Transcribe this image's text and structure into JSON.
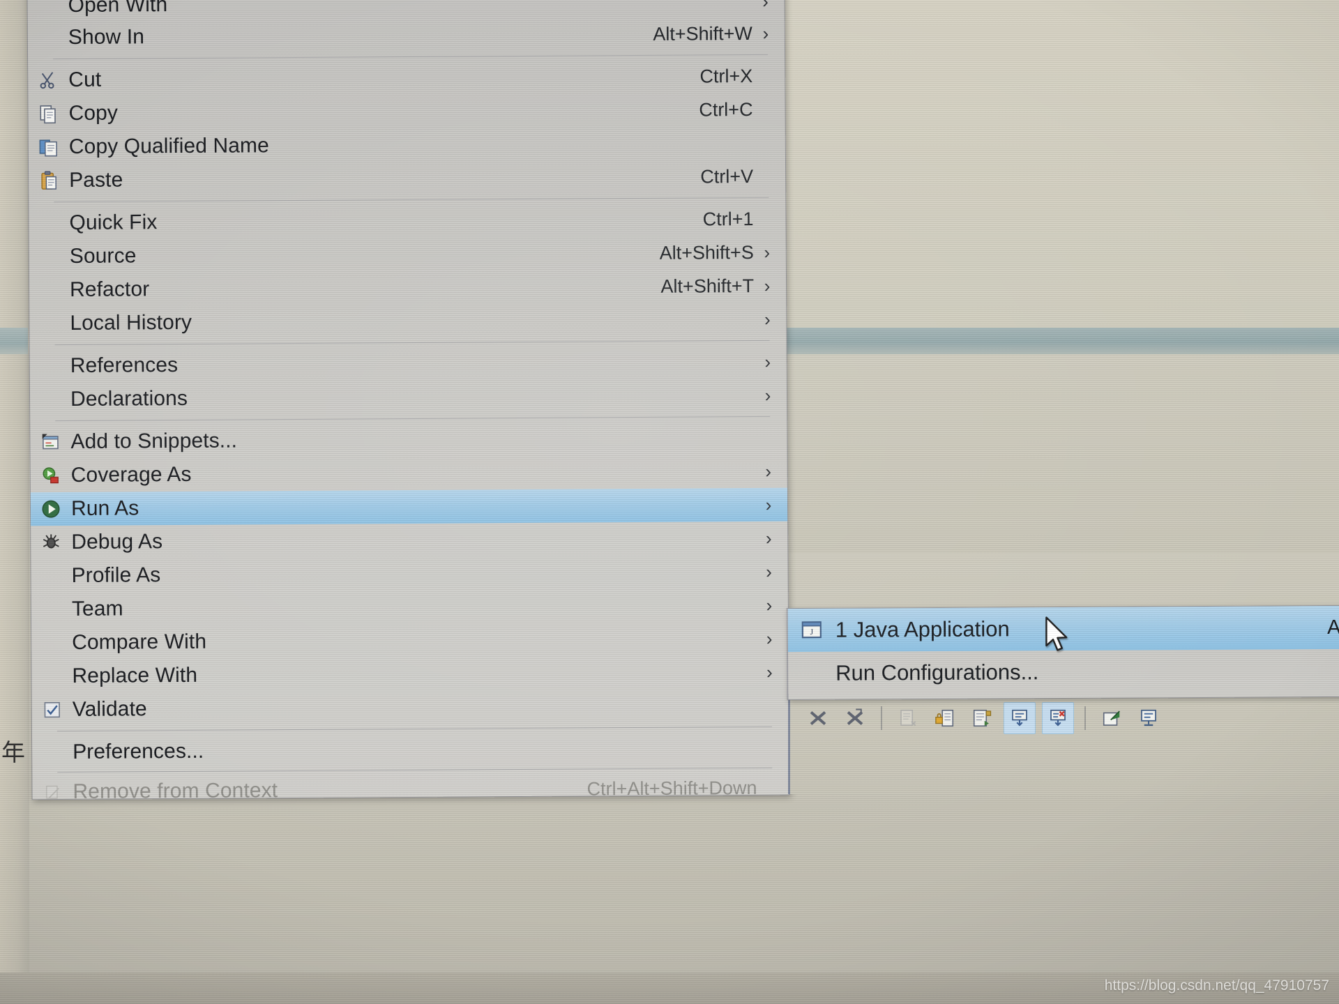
{
  "app": "Eclipse IDE context menu (photo of screen)",
  "watermark": "https://blog.csdn.net/qq_47910757",
  "margin_glyph": "年",
  "context_menu": {
    "items": [
      {
        "label": "Open With",
        "accel": "",
        "arrow": true,
        "icon": "",
        "clipped": true
      },
      {
        "label": "Show In",
        "accel": "Alt+Shift+W",
        "arrow": true,
        "icon": ""
      },
      {
        "sep": true
      },
      {
        "label": "Cut",
        "accel": "Ctrl+X",
        "arrow": false,
        "icon": "scissors-icon"
      },
      {
        "label": "Copy",
        "accel": "Ctrl+C",
        "arrow": false,
        "icon": "copy-icon"
      },
      {
        "label": "Copy Qualified Name",
        "accel": "",
        "arrow": false,
        "icon": "copy-qualified-name-icon"
      },
      {
        "label": "Paste",
        "accel": "Ctrl+V",
        "arrow": false,
        "icon": "paste-icon"
      },
      {
        "sep": true
      },
      {
        "label": "Quick Fix",
        "accel": "Ctrl+1",
        "arrow": false,
        "icon": ""
      },
      {
        "label": "Source",
        "accel": "Alt+Shift+S",
        "arrow": true,
        "icon": ""
      },
      {
        "label": "Refactor",
        "accel": "Alt+Shift+T",
        "arrow": true,
        "icon": ""
      },
      {
        "label": "Local History",
        "accel": "",
        "arrow": true,
        "icon": ""
      },
      {
        "sep": true
      },
      {
        "label": "References",
        "accel": "",
        "arrow": true,
        "icon": ""
      },
      {
        "label": "Declarations",
        "accel": "",
        "arrow": true,
        "icon": ""
      },
      {
        "sep": true
      },
      {
        "label": "Add to Snippets...",
        "accel": "",
        "arrow": false,
        "icon": "snippets-icon"
      },
      {
        "label": "Coverage As",
        "accel": "",
        "arrow": true,
        "icon": "coverage-icon"
      },
      {
        "label": "Run As",
        "accel": "",
        "arrow": true,
        "icon": "run-icon",
        "selected": true
      },
      {
        "label": "Debug As",
        "accel": "",
        "arrow": true,
        "icon": "debug-icon"
      },
      {
        "label": "Profile As",
        "accel": "",
        "arrow": true,
        "icon": ""
      },
      {
        "label": "Team",
        "accel": "",
        "arrow": true,
        "icon": ""
      },
      {
        "label": "Compare With",
        "accel": "",
        "arrow": true,
        "icon": ""
      },
      {
        "label": "Replace With",
        "accel": "",
        "arrow": true,
        "icon": ""
      },
      {
        "label": "Validate",
        "accel": "",
        "arrow": false,
        "icon": "checkbox-checked-icon"
      },
      {
        "sep": true
      },
      {
        "label": "Preferences...",
        "accel": "",
        "arrow": false,
        "icon": ""
      },
      {
        "sep": true
      },
      {
        "label": "Remove from Context",
        "accel": "Ctrl+Alt+Shift+Down",
        "arrow": false,
        "icon": "remove-from-context-icon",
        "disabled": true
      }
    ]
  },
  "run_as_submenu": {
    "items": [
      {
        "label": "1 Java Application",
        "accel": "Al",
        "icon": "java-application-icon",
        "selected": true
      },
      {
        "label": "Run Configurations...",
        "accel": "",
        "icon": ""
      }
    ]
  },
  "console_toolbar": {
    "buttons": [
      {
        "name": "terminate-icon",
        "active": false
      },
      {
        "name": "remove-all-terminated-icon",
        "active": false
      },
      {
        "name": "clear-console-icon",
        "active": false,
        "disabled": true
      },
      {
        "name": "scroll-lock-icon",
        "active": false
      },
      {
        "name": "word-wrap-icon",
        "active": false
      },
      {
        "name": "show-console-on-output-icon",
        "active": true
      },
      {
        "name": "show-console-on-error-icon",
        "active": true
      },
      {
        "name": "pin-console-icon",
        "active": false
      },
      {
        "name": "display-selected-console-icon",
        "active": false
      }
    ]
  },
  "colors": {
    "menu_bg": "#c9c8c4",
    "selection": "#9ec9e6",
    "text": "#16181c",
    "disabled_text": "#8e8d88",
    "separator": "#a2a2a4",
    "console_border": "#5f6f8e"
  }
}
